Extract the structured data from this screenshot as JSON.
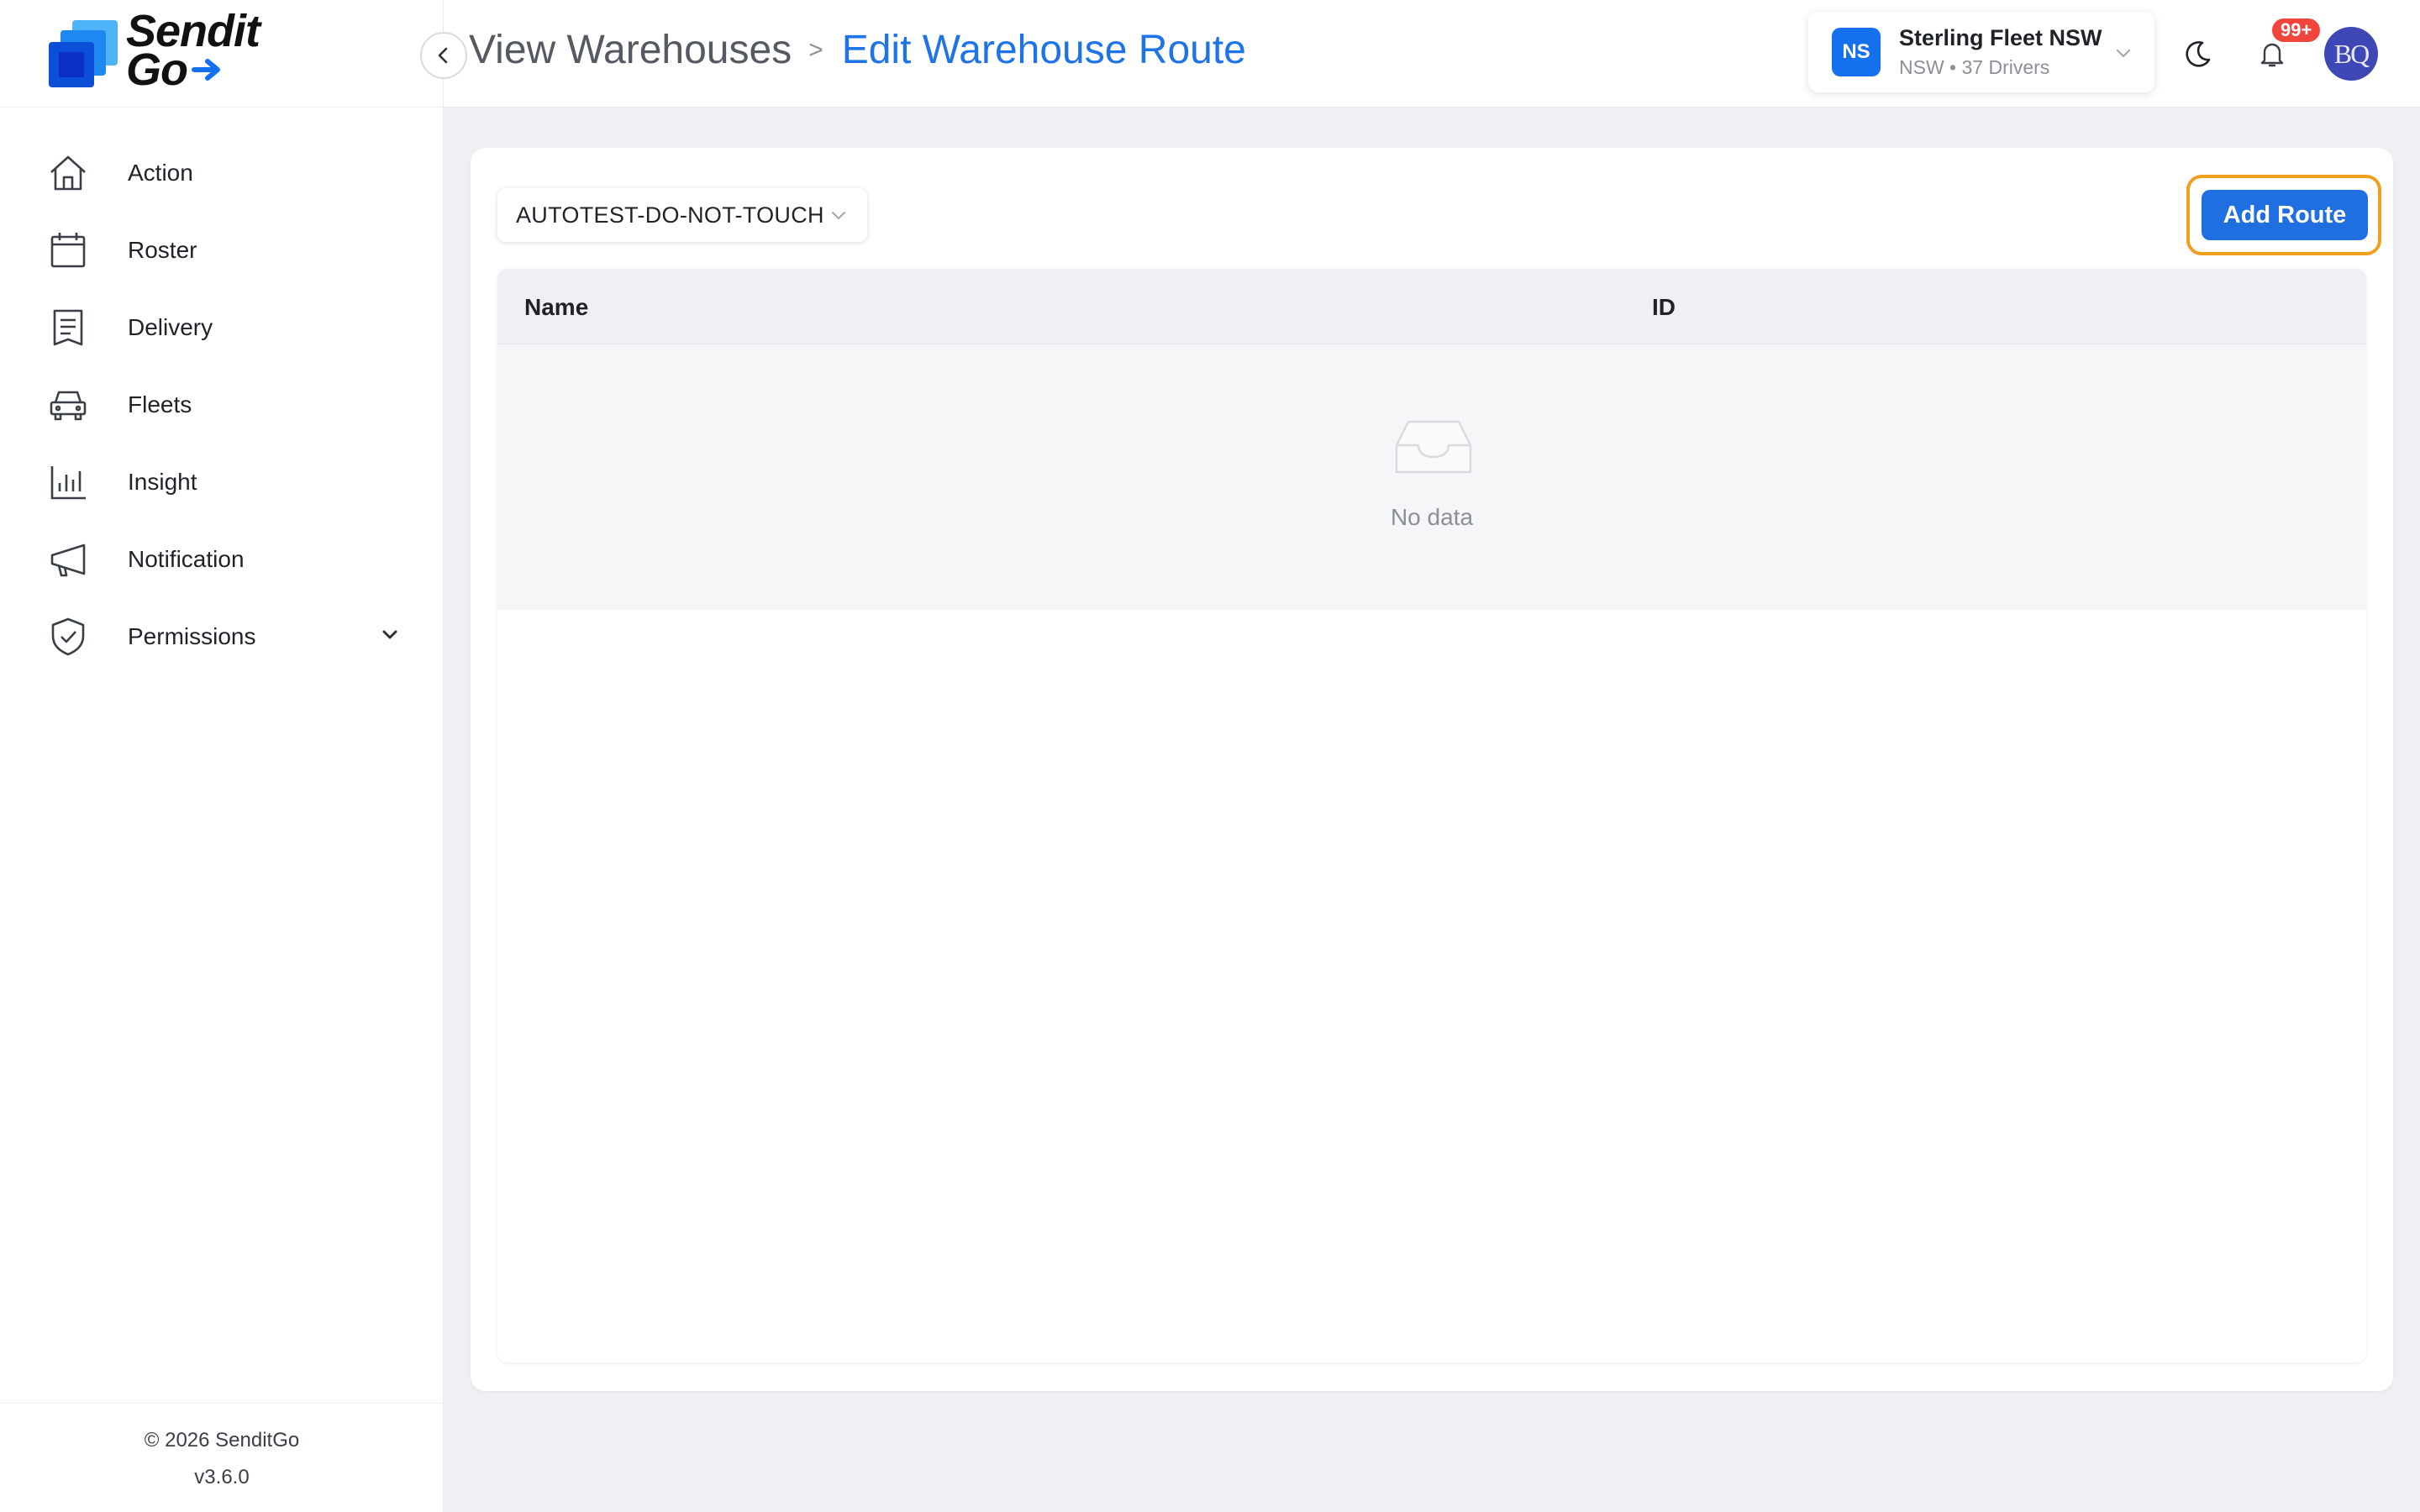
{
  "brand": {
    "line1": "Sendit",
    "line2": "Go",
    "blue": "#1570ef"
  },
  "sidebar": {
    "items": [
      {
        "label": "Action",
        "icon": "home-icon"
      },
      {
        "label": "Roster",
        "icon": "calendar-icon"
      },
      {
        "label": "Delivery",
        "icon": "receipt-icon"
      },
      {
        "label": "Fleets",
        "icon": "car-icon"
      },
      {
        "label": "Insight",
        "icon": "bar-chart-icon"
      },
      {
        "label": "Notification",
        "icon": "megaphone-icon"
      },
      {
        "label": "Permissions",
        "icon": "shield-check-icon",
        "expandable": true
      }
    ],
    "footer": {
      "copyright": "© 2026 SenditGo",
      "version": "v3.6.0"
    }
  },
  "header": {
    "breadcrumb": {
      "root": "View Warehouses",
      "separator": ">",
      "current": "Edit Warehouse Route"
    },
    "fleet": {
      "badge": "NS",
      "name": "Sterling Fleet NSW",
      "sub": "NSW • 37 Drivers"
    },
    "notifications": {
      "count": "99+"
    },
    "avatar": {
      "initials": "BQ"
    }
  },
  "main": {
    "warehouse_select": {
      "value": "AUTOTEST-DO-NOT-TOUCH"
    },
    "add_route_label": "Add Route",
    "table": {
      "columns": [
        "Name",
        "ID"
      ],
      "rows": [],
      "empty_text": "No data"
    }
  },
  "colors": {
    "accent": "#1e73e8",
    "highlight": "#f0a01e",
    "badge": "#f0453c"
  }
}
